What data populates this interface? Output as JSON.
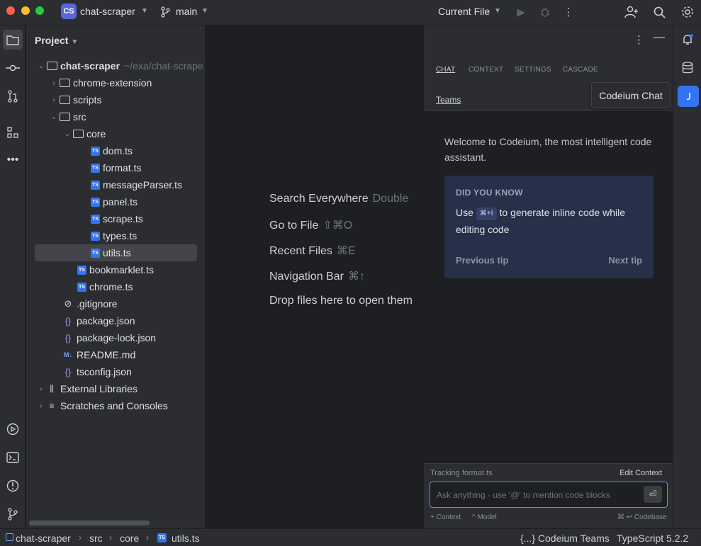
{
  "titlebar": {
    "project_badge": "CS",
    "project_name": "chat-scraper",
    "branch": "main",
    "run_config": "Current File"
  },
  "project_panel": {
    "title": "Project",
    "root": {
      "name": "chat-scraper",
      "path": "~/exa/chat-scrape"
    },
    "items": [
      {
        "label": "chrome-extension"
      },
      {
        "label": "scripts"
      },
      {
        "label": "src"
      },
      {
        "label": "core"
      },
      {
        "label": "dom.ts"
      },
      {
        "label": "format.ts"
      },
      {
        "label": "messageParser.ts"
      },
      {
        "label": "panel.ts"
      },
      {
        "label": "scrape.ts"
      },
      {
        "label": "types.ts"
      },
      {
        "label": "utils.ts"
      },
      {
        "label": "bookmarklet.ts"
      },
      {
        "label": "chrome.ts"
      },
      {
        "label": ".gitignore"
      },
      {
        "label": "package.json"
      },
      {
        "label": "package-lock.json"
      },
      {
        "label": "README.md"
      },
      {
        "label": "tsconfig.json"
      },
      {
        "label": "External Libraries"
      },
      {
        "label": "Scratches and Consoles"
      }
    ],
    "selected": "utils.ts"
  },
  "editor": {
    "hints": [
      {
        "label": "Search Everywhere",
        "shortcut": "Double"
      },
      {
        "label": "Go to File",
        "shortcut": "⇧⌘O"
      },
      {
        "label": "Recent Files",
        "shortcut": "⌘E"
      },
      {
        "label": "Navigation Bar",
        "shortcut": "⌘↑"
      },
      {
        "label": "Drop files here to open them",
        "shortcut": ""
      }
    ]
  },
  "codeium": {
    "tabs": [
      "CHAT",
      "CONTEXT",
      "SETTINGS",
      "CASCADE"
    ],
    "active_tab": "CHAT",
    "teams_link": "Teams",
    "welcome": "Welcome to Codeium, the most intelligent code assistant.",
    "tip": {
      "title": "DID YOU KNOW",
      "pre": "Use",
      "kbd": "⌘+I",
      "post": "to generate inline code while editing code",
      "prev": "Previous tip",
      "next": "Next tip"
    },
    "tracking": "Tracking format.ts",
    "edit_context": "Edit Context",
    "input_placeholder": "Ask anything - use '@' to mention code blocks",
    "footer_context": "+ Context",
    "footer_model": "^ Model",
    "footer_codebase": "⌘ ↩  Codebase",
    "tooltip": "Codeium Chat"
  },
  "statusbar": {
    "crumbs": [
      "chat-scraper",
      "src",
      "core",
      "utils.ts"
    ],
    "teams": "{...} Codeium Teams",
    "language": "TypeScript 5.2.2"
  },
  "colors": {
    "accent": "#3574f0",
    "tip_bg": "#263048",
    "panel_bg": "#2b2d30",
    "editor_bg": "#1e1f22"
  }
}
